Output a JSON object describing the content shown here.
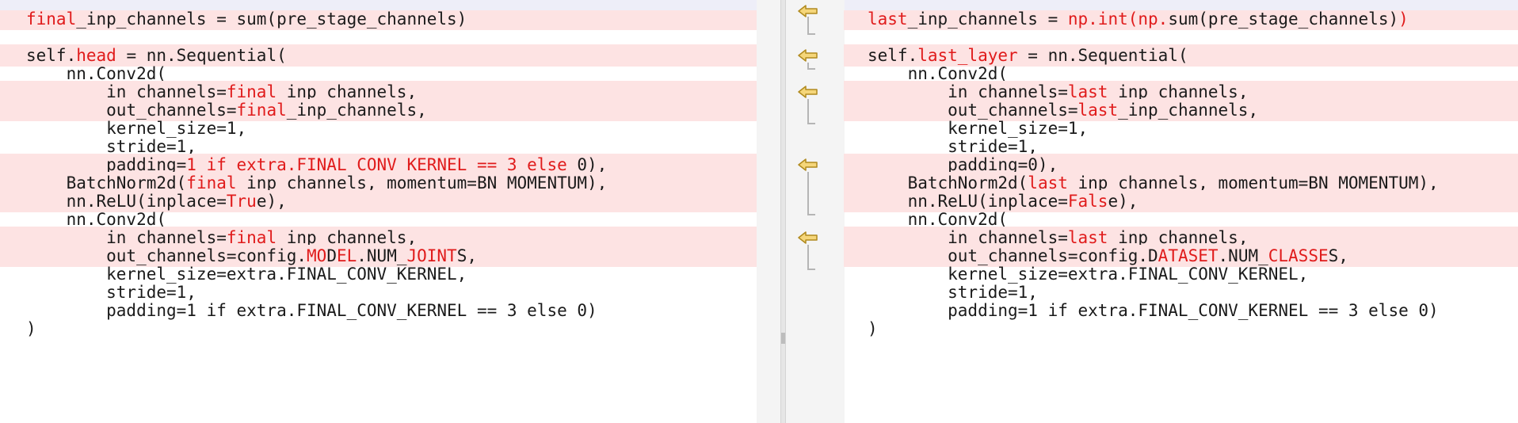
{
  "left": {
    "lines": [
      {
        "changed": true,
        "segments": [
          {
            "t": "final",
            "h": true
          },
          {
            "t": "_inp_channels = sum(pre_stage_channels)",
            "h": false
          }
        ]
      },
      {
        "changed": false,
        "segments": [
          {
            "t": "",
            "h": false
          }
        ]
      },
      {
        "changed": true,
        "segments": [
          {
            "t": "self.",
            "h": false
          },
          {
            "t": "head",
            "h": true
          },
          {
            "t": " = nn.Sequential(",
            "h": false
          }
        ]
      },
      {
        "changed": false,
        "segments": [
          {
            "t": "    nn.Conv2d(",
            "h": false
          }
        ]
      },
      {
        "changed": true,
        "segments": [
          {
            "t": "        in_channels=",
            "h": false
          },
          {
            "t": "final",
            "h": true
          },
          {
            "t": "_inp_channels,",
            "h": false
          }
        ]
      },
      {
        "changed": true,
        "segments": [
          {
            "t": "        out_channels=",
            "h": false
          },
          {
            "t": "final",
            "h": true
          },
          {
            "t": "_inp_channels,",
            "h": false
          }
        ]
      },
      {
        "changed": false,
        "segments": [
          {
            "t": "        kernel_size=1,",
            "h": false
          }
        ]
      },
      {
        "changed": false,
        "segments": [
          {
            "t": "        stride=1,",
            "h": false
          }
        ]
      },
      {
        "changed": true,
        "segments": [
          {
            "t": "        padding=",
            "h": false
          },
          {
            "t": "1 if extra.FINAL_CONV_KERNEL == 3 else ",
            "h": true
          },
          {
            "t": "0),",
            "h": false
          }
        ]
      },
      {
        "changed": true,
        "segments": [
          {
            "t": "    BatchNorm2d(",
            "h": false
          },
          {
            "t": "final",
            "h": true
          },
          {
            "t": "_inp_channels, momentum=BN_MOMENTUM),",
            "h": false
          }
        ]
      },
      {
        "changed": true,
        "segments": [
          {
            "t": "    nn.ReLU(inplace=",
            "h": false
          },
          {
            "t": "Tru",
            "h": true
          },
          {
            "t": "e),",
            "h": false
          }
        ]
      },
      {
        "changed": false,
        "segments": [
          {
            "t": "    nn.Conv2d(",
            "h": false
          }
        ]
      },
      {
        "changed": true,
        "segments": [
          {
            "t": "        in_channels=",
            "h": false
          },
          {
            "t": "final",
            "h": true
          },
          {
            "t": "_inp_channels,",
            "h": false
          }
        ]
      },
      {
        "changed": true,
        "segments": [
          {
            "t": "        out_channels=config.",
            "h": false
          },
          {
            "t": "MO",
            "h": true
          },
          {
            "t": "D",
            "h": false
          },
          {
            "t": "EL",
            "h": true
          },
          {
            "t": ".NUM_",
            "h": false
          },
          {
            "t": "JOINT",
            "h": true
          },
          {
            "t": "S,",
            "h": false
          }
        ]
      },
      {
        "changed": false,
        "segments": [
          {
            "t": "        kernel_size=extra.FINAL_CONV_KERNEL,",
            "h": false
          }
        ]
      },
      {
        "changed": false,
        "segments": [
          {
            "t": "        stride=1,",
            "h": false
          }
        ]
      },
      {
        "changed": false,
        "segments": [
          {
            "t": "        padding=1 if extra.FINAL_CONV_KERNEL == 3 else 0)",
            "h": false
          }
        ]
      },
      {
        "changed": false,
        "segments": [
          {
            "t": ")",
            "h": false
          }
        ]
      }
    ]
  },
  "right": {
    "lines": [
      {
        "changed": true,
        "segments": [
          {
            "t": "last",
            "h": true
          },
          {
            "t": "_inp_channels = ",
            "h": false
          },
          {
            "t": "np.int(np.",
            "h": true
          },
          {
            "t": "sum(pre_stage_channels)",
            "h": false
          },
          {
            "t": ")",
            "h": true
          }
        ]
      },
      {
        "changed": false,
        "segments": [
          {
            "t": "",
            "h": false
          }
        ]
      },
      {
        "changed": true,
        "segments": [
          {
            "t": "self.",
            "h": false
          },
          {
            "t": "last_layer",
            "h": true
          },
          {
            "t": " = nn.Sequential(",
            "h": false
          }
        ]
      },
      {
        "changed": false,
        "segments": [
          {
            "t": "    nn.Conv2d(",
            "h": false
          }
        ]
      },
      {
        "changed": true,
        "segments": [
          {
            "t": "        in_channels=",
            "h": false
          },
          {
            "t": "last",
            "h": true
          },
          {
            "t": "_inp_channels,",
            "h": false
          }
        ]
      },
      {
        "changed": true,
        "segments": [
          {
            "t": "        out_channels=",
            "h": false
          },
          {
            "t": "last",
            "h": true
          },
          {
            "t": "_inp_channels,",
            "h": false
          }
        ]
      },
      {
        "changed": false,
        "segments": [
          {
            "t": "        kernel_size=1,",
            "h": false
          }
        ]
      },
      {
        "changed": false,
        "segments": [
          {
            "t": "        stride=1,",
            "h": false
          }
        ]
      },
      {
        "changed": true,
        "segments": [
          {
            "t": "        padding=0),",
            "h": false
          }
        ]
      },
      {
        "changed": true,
        "segments": [
          {
            "t": "    BatchNorm2d(",
            "h": false
          },
          {
            "t": "last",
            "h": true
          },
          {
            "t": "_inp_channels, momentum=BN_MOMENTUM),",
            "h": false
          }
        ]
      },
      {
        "changed": true,
        "segments": [
          {
            "t": "    nn.ReLU(inplace=",
            "h": false
          },
          {
            "t": "Fals",
            "h": true
          },
          {
            "t": "e),",
            "h": false
          }
        ]
      },
      {
        "changed": false,
        "segments": [
          {
            "t": "    nn.Conv2d(",
            "h": false
          }
        ]
      },
      {
        "changed": true,
        "segments": [
          {
            "t": "        in_channels=",
            "h": false
          },
          {
            "t": "last",
            "h": true
          },
          {
            "t": "_inp_channels,",
            "h": false
          }
        ]
      },
      {
        "changed": true,
        "segments": [
          {
            "t": "        out_channels=config.",
            "h": false
          },
          {
            "t": "D",
            "h": false
          },
          {
            "t": "ATASET",
            "h": true
          },
          {
            "t": ".NUM_",
            "h": false
          },
          {
            "t": "CLASSE",
            "h": true
          },
          {
            "t": "S,",
            "h": false
          }
        ]
      },
      {
        "changed": false,
        "segments": [
          {
            "t": "        kernel_size=extra.FINAL_CONV_KERNEL,",
            "h": false
          }
        ]
      },
      {
        "changed": false,
        "segments": [
          {
            "t": "        stride=1,",
            "h": false
          }
        ]
      },
      {
        "changed": false,
        "segments": [
          {
            "t": "        padding=1 if extra.FINAL_CONV_KERNEL == 3 else 0)",
            "h": false
          }
        ]
      },
      {
        "changed": false,
        "segments": [
          {
            "t": ")",
            "h": false
          }
        ]
      }
    ]
  },
  "gutter": {
    "merge_arrow_icon": "merge-left-arrow-icon",
    "hunks": [
      {
        "first_line": 0,
        "line_count": 1
      },
      {
        "first_line": 2,
        "line_count": 1
      },
      {
        "first_line": 4,
        "line_count": 2
      },
      {
        "first_line": 8,
        "line_count": 3
      },
      {
        "first_line": 12,
        "line_count": 2
      }
    ]
  },
  "colors": {
    "changed_background": "#fde3e3",
    "highlight_text": "#e01b1b",
    "arrow_fill": "#f5d67a",
    "arrow_stroke": "#b08a1e"
  }
}
